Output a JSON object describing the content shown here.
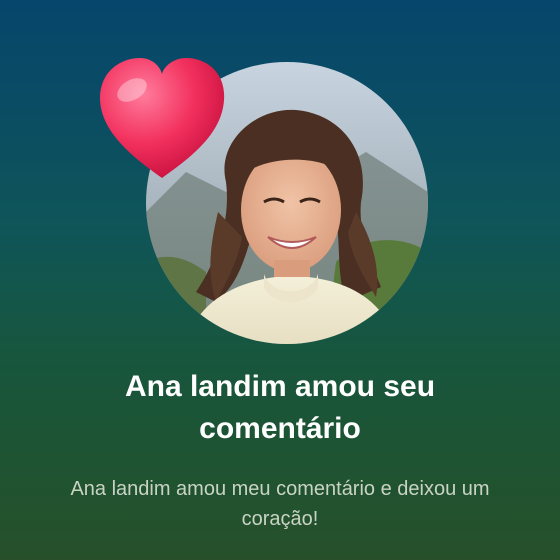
{
  "notification": {
    "title": "Ana landim amou seu comentário",
    "subtitle": "Ana landim amou meu comentário e deixou um coração!",
    "reaction_icon": "heart-icon",
    "colors": {
      "background_top": "#06466c",
      "background_bottom": "#27502a",
      "heart": "#f2305d",
      "title": "#ffffff",
      "subtitle": "#c9d3c4"
    }
  }
}
